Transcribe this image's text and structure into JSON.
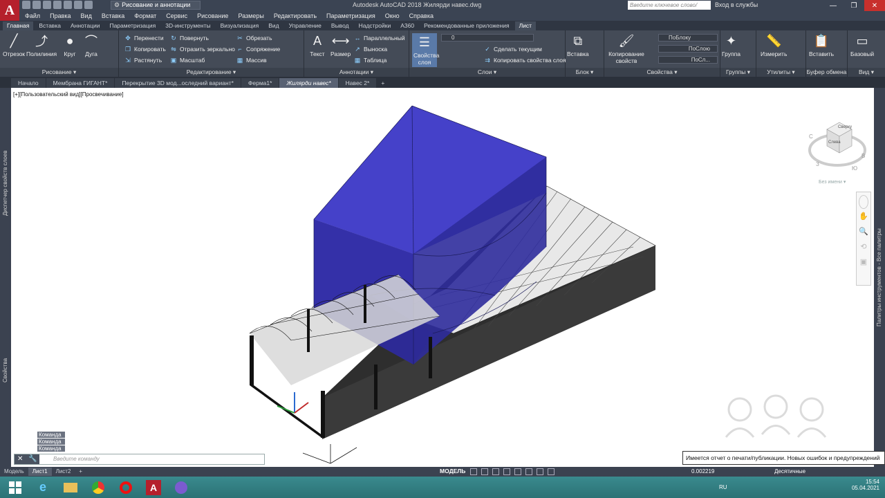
{
  "title_bar": {
    "workspace": "Рисование и аннотации",
    "app_title": "Autodesk AutoCAD 2018    Жилярди навес.dwg",
    "search_placeholder": "Введите ключевое слово/фразу",
    "signin": "Вход в службы"
  },
  "menu": [
    "Файл",
    "Правка",
    "Вид",
    "Вставка",
    "Формат",
    "Сервис",
    "Рисование",
    "Размеры",
    "Редактировать",
    "Параметризация",
    "Окно",
    "Справка"
  ],
  "ribbon_tabs": [
    "Главная",
    "Вставка",
    "Аннотации",
    "Параметризация",
    "3D-инструменты",
    "Визуализация",
    "Вид",
    "Управление",
    "Вывод",
    "Надстройки",
    "A360",
    "Рекомендованные приложения",
    "Лист"
  ],
  "ribbon": {
    "draw": {
      "title": "Рисование",
      "line": "Отрезок",
      "polyline": "Полилиния",
      "circle": "Круг",
      "arc": "Дуга"
    },
    "modify": {
      "title": "Редактирование",
      "move": "Перенести",
      "rotate": "Повернуть",
      "trim": "Обрезать",
      "copy": "Копировать",
      "mirror": "Отразить зеркально",
      "fillet": "Сопряжение",
      "stretch": "Растянуть",
      "scale": "Масштаб",
      "array": "Массив"
    },
    "annotation": {
      "title": "Аннотации",
      "text": "Текст",
      "dimension": "Размер",
      "linear": "Параллельный",
      "leader": "Выноска",
      "table": "Таблица"
    },
    "layers": {
      "title": "Слои",
      "properties": "Свойства слоя",
      "current_layer": "0",
      "make_current": "Сделать текущим",
      "match_layer": "Копировать свойства слоя"
    },
    "block": {
      "title": "Блок",
      "insert": "Вставка"
    },
    "properties": {
      "title": "Свойства",
      "match": "Копирование свойств",
      "color": "ПоБлоку",
      "linetype": "ПоСлою",
      "lineweight": "ПоСл..."
    },
    "groups": {
      "title": "Группы",
      "group": "Группа"
    },
    "utilities": {
      "title": "Утилиты",
      "measure": "Измерить"
    },
    "clipboard": {
      "title": "Буфер обмена",
      "paste": "Вставить"
    },
    "view": {
      "title": "Вид",
      "base": "Базовый"
    }
  },
  "file_tabs": [
    "Начало",
    "Мембрана ГИГАНТ*",
    "Перекрытие 3D мод...оследний вариант*",
    "Ферма1*",
    "Жилярди навес*",
    "Навес 2*"
  ],
  "viewport": {
    "label": "[+][Пользовательский вид][Просвечивание]",
    "unnamed": "Без имени",
    "viewcube_top": "Сверху",
    "viewcube_left": "Слева",
    "compass": [
      "С",
      "В",
      "Ю",
      "З"
    ]
  },
  "left_palette": [
    "Диспетчер свойств слоев",
    "Свойства"
  ],
  "right_palette": "Палитры инструментов - Все палитры",
  "command": {
    "history": [
      "Команда :",
      "Команда :",
      "Команда :"
    ],
    "placeholder": "Введите команду"
  },
  "status_message": "Имеется отчет о печати/публикации. Новых ошибок и предупреждений нет",
  "layout_tabs": [
    "Модель",
    "Лист1",
    "Лист2"
  ],
  "status": {
    "space": "МОДЕЛЬ",
    "scale": "0.002219",
    "units": "Десятичные"
  },
  "taskbar": {
    "lang": "RU",
    "time": "15:54",
    "date": "05.04.2021"
  },
  "colors": {
    "blue_solid": "#3a35b8",
    "dark_gray": "#2e2e2e",
    "ribbon_bg": "#444b57"
  }
}
